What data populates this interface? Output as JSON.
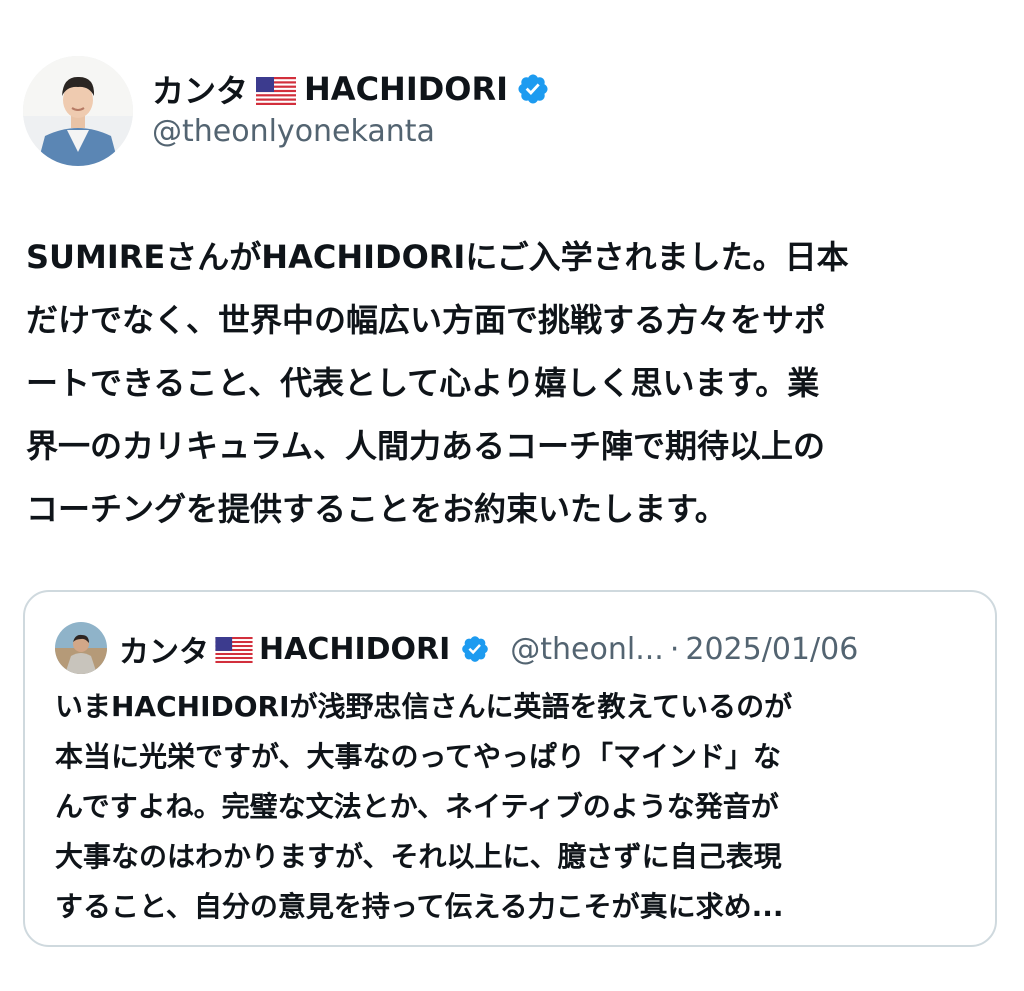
{
  "post": {
    "author": {
      "display_name": "カンタ",
      "flag_icon": "us-flag-icon",
      "name_suffix": "HACHIDORI",
      "verified_icon": "verified-badge-icon",
      "handle": "@theonlyonekanta"
    },
    "text": "SUMIREさんがHACHIDORIにご入学されました。日本\nだけでなく、世界中の幅広い方面で挑戦する方々をサポ\nートできること、代表として心より嬉しく思います。業\n界一のカリキュラム、人間力あるコーチ陣で期待以上の\nコーチングを提供することをお約束いたします。"
  },
  "quoted_post": {
    "author": {
      "display_name": "カンタ",
      "flag_icon": "us-flag-icon",
      "name_suffix": "HACHIDORI",
      "verified_icon": "verified-badge-icon",
      "handle": "@theonl...",
      "separator": "·",
      "date": "2025/01/06"
    },
    "text": "いまHACHIDORIが浅野忠信さんに英語を教えているのが\n本当に光栄ですが、大事なのってやっぱり「マインド」な\nんですよね。完璧な文法とか、ネイティブのような発音が\n大事なのはわかりますが、それ以上に、臆さずに自己表現\nすること、自分の意見を持って伝える力こそが真に求め..."
  },
  "colors": {
    "text": "#0f1419",
    "secondary": "#536471",
    "verified": "#1d9bf0",
    "border": "#cfd9de"
  }
}
